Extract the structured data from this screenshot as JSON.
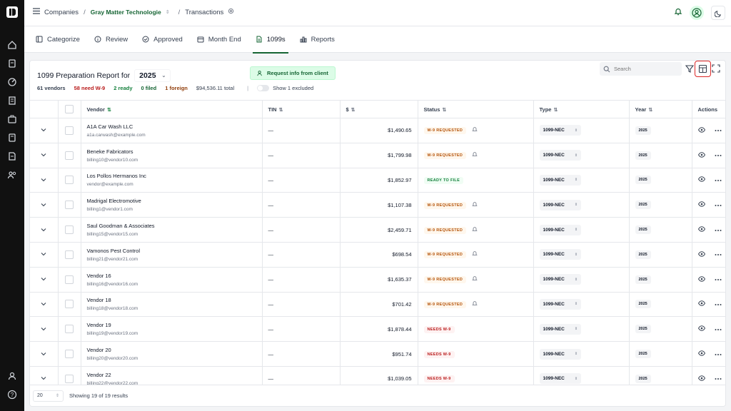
{
  "breadcrumb": {
    "companies": "Companies",
    "company": "Gray Matter Technologie",
    "page": "Transactions"
  },
  "tabs": [
    {
      "label": "Categorize",
      "icon": "categorize-icon"
    },
    {
      "label": "Review",
      "icon": "info-icon"
    },
    {
      "label": "Approved",
      "icon": "check-circle-icon"
    },
    {
      "label": "Month End",
      "icon": "calendar-icon"
    },
    {
      "label": "1099s",
      "icon": "document-icon",
      "active": true
    },
    {
      "label": "Reports",
      "icon": "bar-chart-icon"
    }
  ],
  "report": {
    "title": "1099 Preparation Report for",
    "year": "2025",
    "request_button": "Request info from client",
    "search_placeholder": "Search"
  },
  "stats": {
    "vendors": "61 vendors",
    "need_w9": "58 need W-9",
    "ready": "2 ready",
    "filed": "0 filed",
    "foreign": "1 foreign",
    "total": "$94,536.11 total",
    "divider": "|",
    "excluded": "Show 1 excluded"
  },
  "table": {
    "headers": {
      "vendor": "Vendor",
      "tin": "TIN",
      "amount": "$",
      "status": "Status",
      "type": "Type",
      "year": "Year",
      "actions": "Actions"
    },
    "rows": [
      {
        "name": "A1A Car Wash LLC",
        "email": "a1a.carwash@example.com",
        "tin": "—",
        "amount": "$1,490.65",
        "status": "W-9 REQUESTED",
        "type": "1099-NEC",
        "year": "2025"
      },
      {
        "name": "Beneke Fabricators",
        "email": "billing10@vendor10.com",
        "tin": "—",
        "amount": "$1,799.98",
        "status": "W-9 REQUESTED",
        "type": "1099-NEC",
        "year": "2025"
      },
      {
        "name": "Los Pollos Hermanos Inc",
        "email": "vendor@example.com",
        "tin": "—",
        "amount": "$1,852.97",
        "status": "READY TO FILE",
        "type": "1099-NEC",
        "year": "2025"
      },
      {
        "name": "Madrigal Electromotive",
        "email": "billing1@vendor1.com",
        "tin": "—",
        "amount": "$1,107.38",
        "status": "W-9 REQUESTED",
        "type": "1099-NEC",
        "year": "2025"
      },
      {
        "name": "Saul Goodman & Associates",
        "email": "billing15@vendor15.com",
        "tin": "—",
        "amount": "$2,459.71",
        "status": "W-9 REQUESTED",
        "type": "1099-NEC",
        "year": "2025"
      },
      {
        "name": "Vamonos Pest Control",
        "email": "billing21@vendor21.com",
        "tin": "—",
        "amount": "$698.54",
        "status": "W-9 REQUESTED",
        "type": "1099-NEC",
        "year": "2025"
      },
      {
        "name": "Vendor 16",
        "email": "billing16@vendor16.com",
        "tin": "—",
        "amount": "$1,635.37",
        "status": "W-9 REQUESTED",
        "type": "1099-NEC",
        "year": "2025"
      },
      {
        "name": "Vendor 18",
        "email": "billing18@vendor18.com",
        "tin": "—",
        "amount": "$701.42",
        "status": "W-9 REQUESTED",
        "type": "1099-NEC",
        "year": "2025"
      },
      {
        "name": "Vendor 19",
        "email": "billing19@vendor19.com",
        "tin": "—",
        "amount": "$1,878.44",
        "status": "NEEDS W-9",
        "type": "1099-NEC",
        "year": "2025"
      },
      {
        "name": "Vendor 20",
        "email": "billing20@vendor20.com",
        "tin": "—",
        "amount": "$951.74",
        "status": "NEEDS W-9",
        "type": "1099-NEC",
        "year": "2025"
      },
      {
        "name": "Vendor 22",
        "email": "billing22@vendor22.com",
        "tin": "—",
        "amount": "$1,039.05",
        "status": "NEEDS W-9",
        "type": "1099-NEC",
        "year": "2025"
      }
    ]
  },
  "footer": {
    "page_size": "20",
    "results": "Showing 19 of 19 results"
  },
  "colors": {
    "brand_green": "#166534",
    "need_w9": "#b91c1c",
    "ready": "#15803d",
    "foreign": "#92400e",
    "highlight": "#dc2626"
  }
}
